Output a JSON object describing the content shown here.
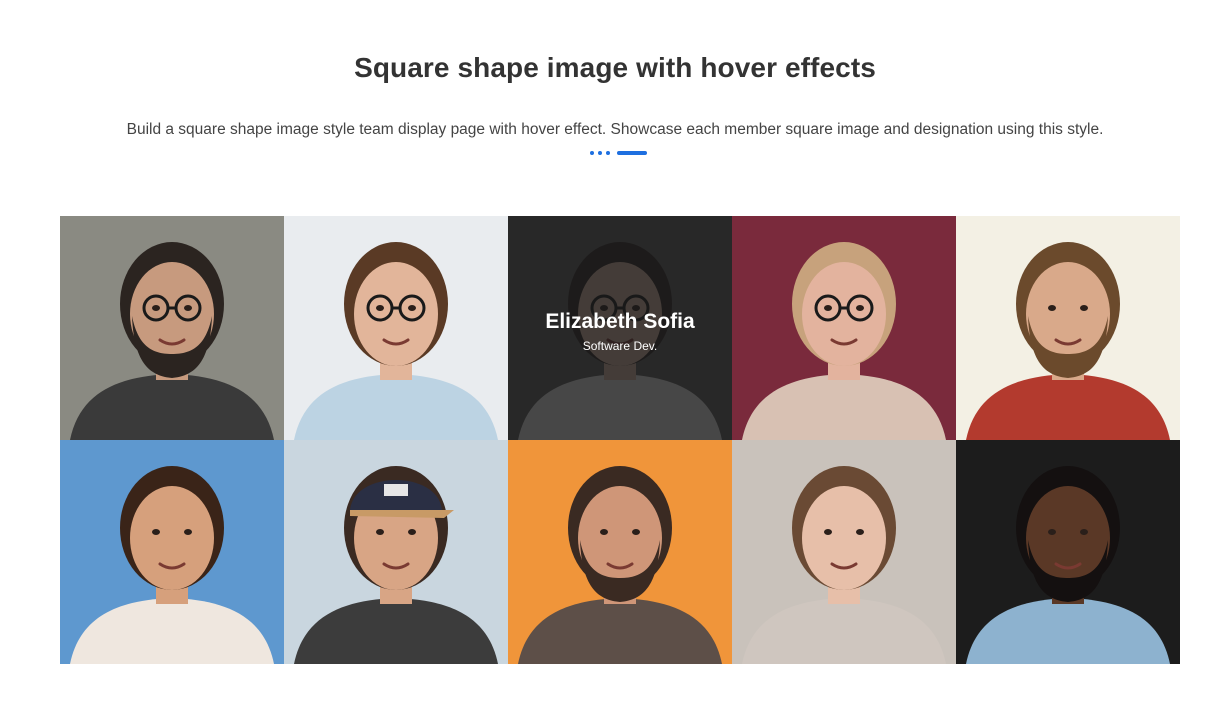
{
  "header": {
    "title": "Square shape image with hover effects",
    "subtitle": "Build a square shape image style team display page with hover effect. Showcase each member square image and designation using this style.",
    "accent_color": "#1e6fe0"
  },
  "team": [
    {
      "photo": "man-glasses-beard-closeup",
      "bg": "#8a8a82",
      "skin": "#c79a7e",
      "hair": "#2b2420",
      "shirt": "#3a3a3a",
      "beard": true,
      "glasses": true,
      "cap": false
    },
    {
      "photo": "man-glasses-smiling",
      "bg": "#e9ecef",
      "skin": "#e2b59a",
      "hair": "#5a3a25",
      "shirt": "#bcd3e3",
      "beard": false,
      "glasses": true,
      "cap": false
    },
    {
      "photo": "woman-glasses-blouse",
      "bg": "#5a5a5a",
      "skin": "#d9b7a3",
      "hair": "#2a2220",
      "shirt": "#e6e6e6",
      "beard": false,
      "glasses": true,
      "cap": false,
      "name": "Elizabeth Sofia",
      "role": "Software Dev."
    },
    {
      "photo": "woman-glasses-neon",
      "bg": "#7a2a3c",
      "skin": "#e3b39e",
      "hair": "#c7a27c",
      "shirt": "#d8c1b3",
      "beard": false,
      "glasses": true,
      "cap": false
    },
    {
      "photo": "man-beard-plaid-shirt",
      "bg": "#f3f0e4",
      "skin": "#d9a98a",
      "hair": "#6b4a2c",
      "shirt": "#b33a2e",
      "beard": true,
      "glasses": false,
      "cap": false
    },
    {
      "photo": "woman-curly-hair-beach",
      "bg": "#5e98cf",
      "skin": "#d6a07c",
      "hair": "#3a2418",
      "shirt": "#efe7df",
      "beard": false,
      "glasses": false,
      "cap": false
    },
    {
      "photo": "man-cap-smiling",
      "bg": "#c9d6df",
      "skin": "#d8a585",
      "hair": "#3a2a22",
      "shirt": "#3c3c3c",
      "beard": false,
      "glasses": false,
      "cap": true
    },
    {
      "photo": "man-laughing-orange",
      "bg": "#f0953a",
      "skin": "#cf9678",
      "hair": "#3a2a22",
      "shirt": "#5d4f48",
      "beard": true,
      "glasses": false,
      "cap": false
    },
    {
      "photo": "woman-freckles",
      "bg": "#c9c2bb",
      "skin": "#e7bfa9",
      "hair": "#6a4a34",
      "shirt": "#cfc6bf",
      "beard": false,
      "glasses": false,
      "cap": false
    },
    {
      "photo": "man-dark-skin-beard",
      "bg": "#1c1c1c",
      "skin": "#5a3826",
      "hair": "#141010",
      "shirt": "#8db2cf",
      "beard": true,
      "glasses": false,
      "cap": false
    }
  ]
}
